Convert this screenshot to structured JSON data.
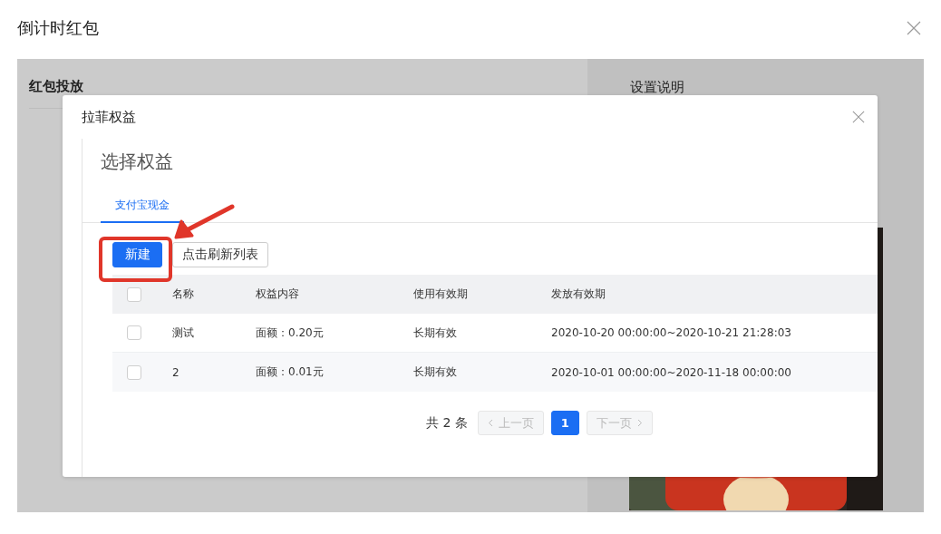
{
  "dialog": {
    "title": "倒计时红包"
  },
  "left_panel": {
    "title": "红包投放"
  },
  "right_panel": {
    "title": "设置说明"
  },
  "modal": {
    "title": "拉菲权益",
    "heading": "选择权益",
    "tabs": [
      {
        "label": "支付宝现金",
        "selected": true
      }
    ],
    "buttons": [
      {
        "label": "新建",
        "kind": "primary"
      },
      {
        "label": "点击刷新列表",
        "kind": "default"
      }
    ],
    "table": {
      "header_checked": false,
      "columns": [
        "名称",
        "权益内容",
        "使用有效期",
        "发放有效期"
      ],
      "rows": [
        {
          "checked": false,
          "cells": [
            "测试",
            "面额：0.20元",
            "长期有效",
            "2020-10-20 00:00:00~2020-10-21 21:28:03"
          ]
        },
        {
          "checked": false,
          "cells": [
            "2",
            "面额：0.01元",
            "长期有效",
            "2020-10-01 00:00:00~2020-11-18 00:00:00"
          ]
        }
      ]
    },
    "pagination": {
      "total": "共 2 条",
      "prev": {
        "label": "上一页",
        "disabled": true
      },
      "pages": [
        {
          "label": "1",
          "selected": true
        }
      ],
      "next": {
        "label": "下一页",
        "disabled": true
      }
    }
  }
}
